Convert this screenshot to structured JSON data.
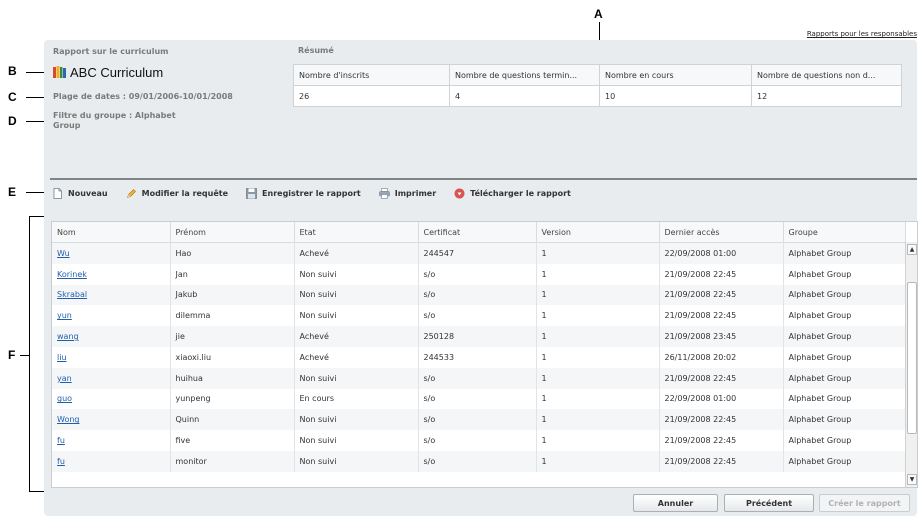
{
  "callouts": {
    "a": "A",
    "b": "B",
    "c": "C",
    "d": "D",
    "e": "E",
    "f": "F"
  },
  "header": {
    "top_link": "Rapports pour les responsables",
    "report_title": "Rapport sur le curriculum",
    "curriculum_name": "ABC Curriculum",
    "date_range": "Plage de dates : 09/01/2006-10/01/2008",
    "group_filter_line1": "Filtre du groupe : Alphabet",
    "group_filter_line2": "Group"
  },
  "summary": {
    "label": "Résumé",
    "headers": [
      "Nombre d'inscrits",
      "Nombre de questions termin...",
      "Nombre en cours",
      "Nombre de questions non d..."
    ],
    "values": [
      "26",
      "4",
      "10",
      "12"
    ]
  },
  "toolbar": {
    "new": "Nouveau",
    "modify": "Modifier la requête",
    "save": "Enregistrer le rapport",
    "print": "Imprimer",
    "download": "Télécharger le rapport"
  },
  "grid": {
    "columns": [
      "Nom",
      "Prénom",
      "Etat",
      "Certificat",
      "Version",
      "Dernier accès",
      "Groupe"
    ],
    "rows": [
      [
        "Wu",
        "Hao",
        "Achevé",
        "244547",
        "1",
        "22/09/2008 01:00",
        "Alphabet Group"
      ],
      [
        "Korinek",
        "Jan",
        "Non suivi",
        "s/o",
        "1",
        "21/09/2008 22:45",
        "Alphabet Group"
      ],
      [
        "Skrabal",
        "Jakub",
        "Non suivi",
        "s/o",
        "1",
        "21/09/2008 22:45",
        "Alphabet Group"
      ],
      [
        "yun",
        "dilemma",
        "Non suivi",
        "s/o",
        "1",
        "21/09/2008 22:45",
        "Alphabet Group"
      ],
      [
        "wang",
        "jie",
        "Achevé",
        "250128",
        "1",
        "21/09/2008 23:45",
        "Alphabet Group"
      ],
      [
        "liu",
        "xiaoxi.liu",
        "Achevé",
        "244533",
        "1",
        "26/11/2008 20:02",
        "Alphabet Group"
      ],
      [
        "yan",
        "huihua",
        "Non suivi",
        "s/o",
        "1",
        "21/09/2008 22:45",
        "Alphabet Group"
      ],
      [
        "guo",
        "yunpeng",
        "En cours",
        "s/o",
        "1",
        "22/09/2008 01:00",
        "Alphabet Group"
      ],
      [
        "Wong",
        "Quinn",
        "Non suivi",
        "s/o",
        "1",
        "21/09/2008 22:45",
        "Alphabet Group"
      ],
      [
        "fu",
        "five",
        "Non suivi",
        "s/o",
        "1",
        "21/09/2008 22:45",
        "Alphabet Group"
      ],
      [
        "fu",
        "monitor",
        "Non suivi",
        "s/o",
        "1",
        "21/09/2008 22:45",
        "Alphabet Group"
      ]
    ]
  },
  "footer": {
    "cancel": "Annuler",
    "previous": "Précédent",
    "create": "Créer le rapport"
  }
}
